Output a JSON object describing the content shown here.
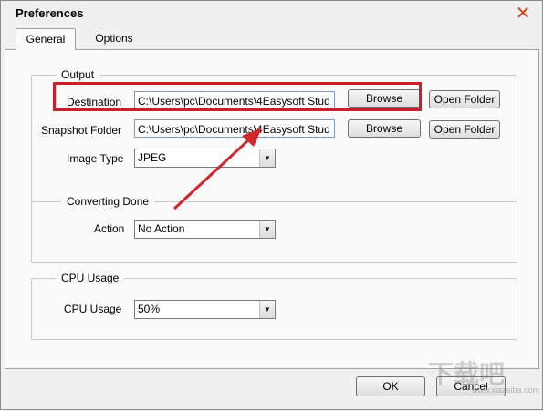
{
  "window": {
    "title": "Preferences",
    "close_glyph": "✕"
  },
  "tabs": [
    {
      "label": "General",
      "active": true
    },
    {
      "label": "Options",
      "active": false
    }
  ],
  "output": {
    "legend": "Output",
    "destination_label": "Destination",
    "destination_value": "C:\\Users\\pc\\Documents\\4Easysoft Stud",
    "snapshot_label": "Snapshot Folder",
    "snapshot_value": "C:\\Users\\pc\\Documents\\4Easysoft Stud",
    "browse_label": "Browse",
    "open_folder_label": "Open Folder",
    "image_type_label": "Image Type",
    "image_type_value": "JPEG"
  },
  "converting_done": {
    "legend": "Converting Done",
    "action_label": "Action",
    "action_value": "No Action"
  },
  "cpu": {
    "legend": "CPU Usage",
    "cpu_label": "CPU Usage",
    "cpu_value": "50%"
  },
  "footer": {
    "ok_label": "OK",
    "cancel_label": "Cancel"
  },
  "watermark": {
    "text": "下载吧",
    "sub": "www.xiazaiba.com"
  },
  "colors": {
    "highlight": "#cc1f2a",
    "close": "#d0451b"
  },
  "icons": {
    "close": "close-icon",
    "dropdown": "chevron-down-icon",
    "annotation": "red-arrow"
  }
}
